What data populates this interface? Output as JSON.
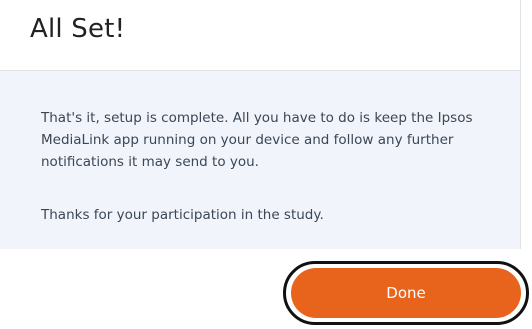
{
  "dialog": {
    "title": "All Set!",
    "message": "That's it, setup is complete. All you have to do is keep the Ipsos MediaLink app running on your device and follow any further notifications it may send to you.",
    "thanks": "Thanks for your participation in the study.",
    "done_label": "Done"
  },
  "colors": {
    "accent": "#e8631c",
    "panel_background": "#f1f5fb",
    "text": "#3b4656"
  }
}
